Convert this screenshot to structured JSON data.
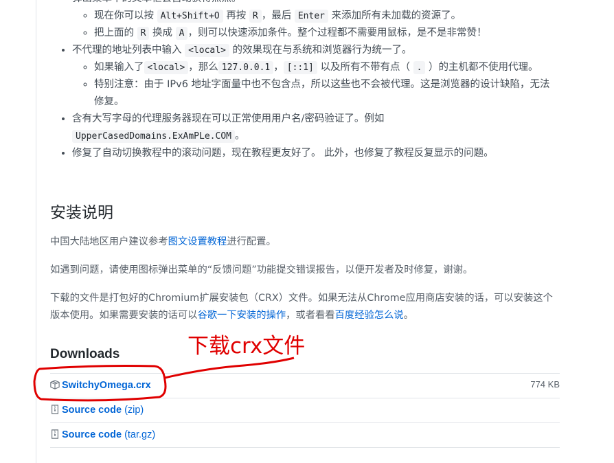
{
  "list": {
    "item1_sub1": {
      "t1": "现在你可以按",
      "c1": "Alt+Shift+O",
      "t2": "再按",
      "c2": "R",
      "t3": "，最后",
      "c3": "Enter",
      "t4": "来添加所有未加载的资源了。"
    },
    "item1_sub2": {
      "t1": "把上面的",
      "c1": "R",
      "t2": "换成",
      "c2": "A",
      "t3": "，则可以快速添加条件。整个过程都不需要用鼠标，是不是非常赞！"
    },
    "item2": {
      "t1": "不代理的地址列表中输入",
      "c1": "<local>",
      "t2": "的效果现在与系统和浏览器行为统一了。"
    },
    "item2_sub1": {
      "t1": "如果输入了",
      "c1": "<local>",
      "t2": "，那么",
      "c2": "127.0.0.1",
      "t3": "，",
      "c3": "[::1]",
      "t4": "以及所有不带有点（",
      "c4": ".",
      "t5": "）的主机都不使用代理。"
    },
    "item2_sub2": {
      "t1": "特别注意：由于 IPv6 地址字面量中也不包含点，所以这些也不会被代理。这是浏览器的设计缺陷，无法修复。"
    },
    "item3": {
      "t1": "含有大写字母的代理服务器现在可以正常使用用户名/密码验证了。例如",
      "c1": "UpperCasedDomains.ExAmPLe.COM",
      "t2": "。"
    },
    "item4": {
      "t1": "修复了自动切换教程中的滚动问题，现在教程更友好了。 此外，也修复了教程反复显示的问题。"
    }
  },
  "install": {
    "heading": "安装说明",
    "p1_pre": "中国大陆地区用户建议参考",
    "p1_link": "图文设置教程",
    "p1_post": "进行配置。",
    "p2": "如遇到问题，请使用图标弹出菜单的“反馈问题”功能提交错误报告，以便开发者及时修复，谢谢。",
    "p3_pre": "下载的文件是打包好的Chromium扩展安装包（CRX）文件。如果无法从Chrome应用商店安装的话，可以安装这个版本使用。如果需要安装的话可以",
    "p3_link1": "谷歌一下安装的操作",
    "p3_mid": "，或者看看",
    "p3_link2": "百度经验怎么说",
    "p3_post": "。"
  },
  "downloads": {
    "heading": "Downloads",
    "assets": [
      {
        "name": "SwitchyOmega.crx",
        "suffix": "",
        "size": "774 KB",
        "icon": "package-icon"
      },
      {
        "name": "Source code",
        "suffix": "(zip)",
        "size": "",
        "icon": "file-zip-icon"
      },
      {
        "name": "Source code",
        "suffix": "(tar.gz)",
        "size": "",
        "icon": "file-zip-icon"
      }
    ]
  },
  "annotation": {
    "text": "下载crx文件",
    "color": "#e00000"
  }
}
